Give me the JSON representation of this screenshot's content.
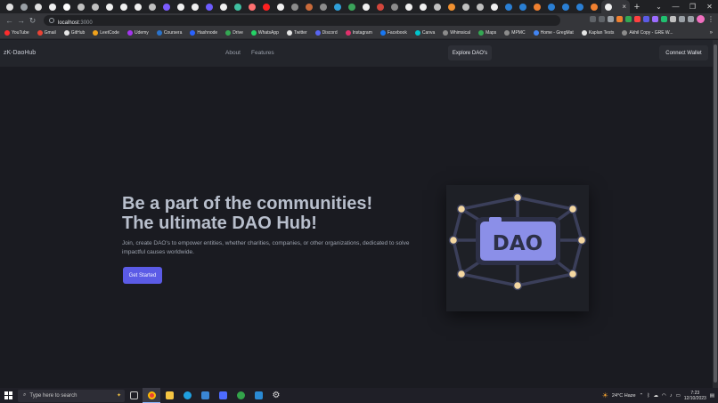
{
  "browser": {
    "active_tab_close": "×",
    "new_tab": "+",
    "window_controls": [
      "⌄",
      "—",
      "❐",
      "✕"
    ],
    "nav": {
      "back": "←",
      "forward": "→",
      "reload": "↻"
    },
    "url": {
      "host": "localhost",
      "port": ":3000"
    },
    "bookmarks": [
      {
        "label": "YouTube",
        "color": "#ff2d2d"
      },
      {
        "label": "Gmail",
        "color": "#ea4335"
      },
      {
        "label": "GitHub",
        "color": "#e6e6e6"
      },
      {
        "label": "LeetCode",
        "color": "#f0a21c"
      },
      {
        "label": "Udemy",
        "color": "#a435f0"
      },
      {
        "label": "Coursera",
        "color": "#2a73cc"
      },
      {
        "label": "Hashnode",
        "color": "#2962ff"
      },
      {
        "label": "Drive",
        "color": "#34a853"
      },
      {
        "label": "WhatsApp",
        "color": "#25d366"
      },
      {
        "label": "Twitter",
        "color": "#e6e6e6"
      },
      {
        "label": "Discord",
        "color": "#5865f2"
      },
      {
        "label": "Instagram",
        "color": "#e1306c"
      },
      {
        "label": "Facebook",
        "color": "#1877f2"
      },
      {
        "label": "Canva",
        "color": "#00c4cc"
      },
      {
        "label": "Whimsical",
        "color": "#8c8c8c"
      },
      {
        "label": "Maps",
        "color": "#34a853"
      },
      {
        "label": "MPMC",
        "color": "#8c8c8c"
      },
      {
        "label": "Home - GregMat",
        "color": "#4285f4"
      },
      {
        "label": "Kaplan Tests",
        "color": "#e6e6e6"
      },
      {
        "label": "Akhil Copy - GRE W...",
        "color": "#8c8c8c"
      }
    ],
    "bookmarks_more": "»"
  },
  "site": {
    "brand": "zK-DaoHub",
    "nav_links": [
      "About",
      "Features"
    ],
    "explore_button": "Explore DAO's",
    "wallet_button": "Connect Wallet",
    "hero_line1": "Be a part of the communities!",
    "hero_line2": "The ultimate DAO Hub!",
    "hero_text": "Join, create DAO's to empower entities, whether charities, companies, or other organizations, dedicated to solve impactful causes worldwide.",
    "cta_button": "Get Started",
    "illustration_text": "DAO"
  },
  "taskbar": {
    "search_placeholder": "Type here to search",
    "weather": "24°C  Haze",
    "time": "7:23",
    "date": "12/10/2023"
  },
  "colors": {
    "page_bg": "#1a1b21",
    "nav_bg": "#23252b",
    "accent": "#5b5be6",
    "dao_plate": "#8b8fe8",
    "dao_node": "#f4d7a1",
    "dao_frame": "#3b3f5a"
  }
}
